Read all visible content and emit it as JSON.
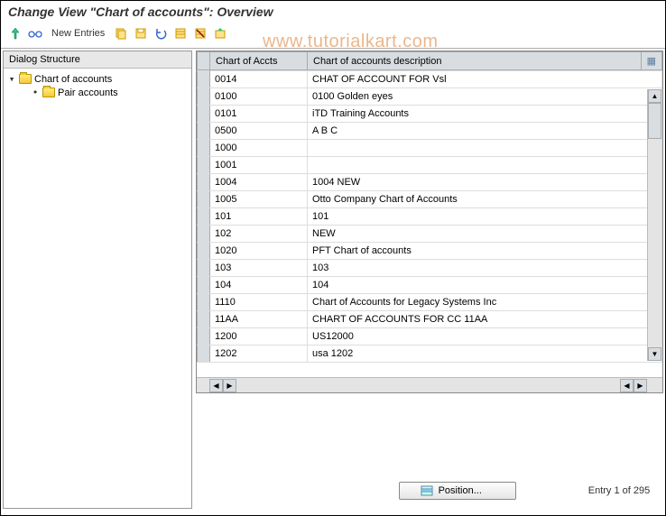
{
  "header": {
    "title": "Change View \"Chart of accounts\": Overview"
  },
  "toolbar": {
    "new_entries": "New Entries"
  },
  "tree": {
    "header": "Dialog Structure",
    "nodes": [
      {
        "label": "Chart of accounts",
        "level": 0,
        "open": true
      },
      {
        "label": "Pair accounts",
        "level": 1,
        "open": false
      }
    ]
  },
  "table": {
    "col1": "Chart of Accts",
    "col2": "Chart of accounts description",
    "rows": [
      {
        "code": "0014",
        "desc": "CHAT OF ACCOUNT FOR Vsl"
      },
      {
        "code": "0100",
        "desc": "0100 Golden eyes"
      },
      {
        "code": "0101",
        "desc": "iTD Training Accounts"
      },
      {
        "code": "0500",
        "desc": "A B C"
      },
      {
        "code": "1000",
        "desc": ""
      },
      {
        "code": "1001",
        "desc": ""
      },
      {
        "code": "1004",
        "desc": "1004 NEW"
      },
      {
        "code": "1005",
        "desc": "Otto Company Chart of Accounts"
      },
      {
        "code": "101",
        "desc": "101"
      },
      {
        "code": "102",
        "desc": "NEW"
      },
      {
        "code": "1020",
        "desc": "PFT Chart of accounts"
      },
      {
        "code": "103",
        "desc": "103"
      },
      {
        "code": "104",
        "desc": "104"
      },
      {
        "code": "1110",
        "desc": "Chart of Accounts for Legacy Systems Inc"
      },
      {
        "code": "11AA",
        "desc": "CHART OF ACCOUNTS FOR CC 11AA"
      },
      {
        "code": "1200",
        "desc": "US12000"
      },
      {
        "code": "1202",
        "desc": "usa 1202"
      }
    ]
  },
  "footer": {
    "position_label": "Position...",
    "entry_text": "Entry 1 of 295"
  },
  "watermark": "www.tutorialkart.com"
}
